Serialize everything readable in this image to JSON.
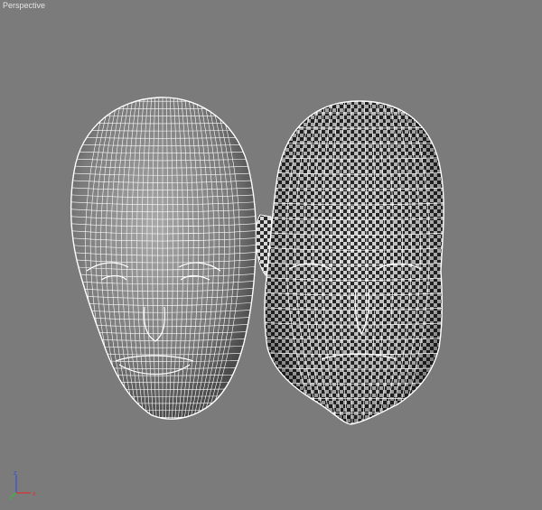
{
  "viewport": {
    "label": "Perspective"
  },
  "gizmo": {
    "x_label": "x",
    "y_label": "y",
    "z_label": "z",
    "x_color": "#e03030",
    "y_color": "#30c030",
    "z_color": "#3050e0"
  },
  "colors": {
    "background": "#7b7b7b",
    "wire": "#ffffff"
  },
  "icons": {
    "left_model": "wireframe-head-icon",
    "right_model": "checker-shaded-head-icon"
  }
}
